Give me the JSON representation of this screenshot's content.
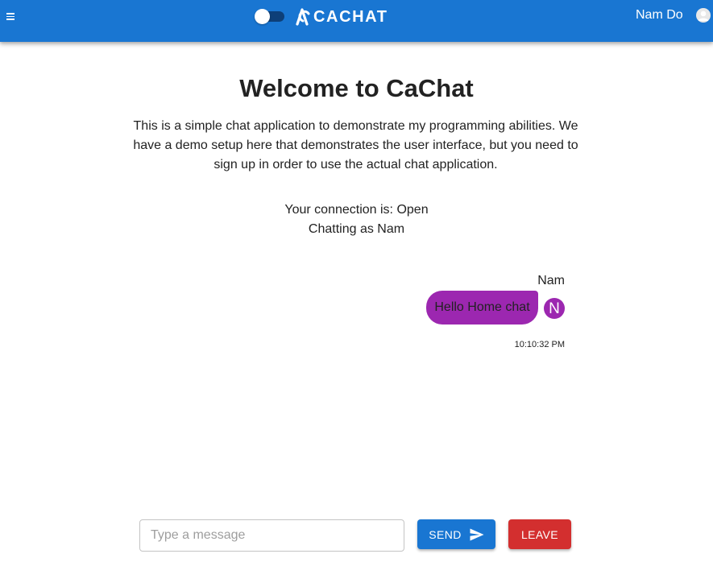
{
  "header": {
    "app_name": "CACHAT",
    "user_name": "Nam Do",
    "brand_color": "#1976d2",
    "icons": {
      "menu": "hamburger-menu-icon",
      "theme_toggle": "toggle-switch",
      "logo": "cachat-logo-icon",
      "user": "account-circle-icon"
    }
  },
  "main": {
    "title": "Welcome to CaChat",
    "intro": "This is a simple chat application to demonstrate my programming abilities. We have a demo setup here that demonstrates the user interface, but you need to sign up in order to use the actual chat application.",
    "connection_status": "Your connection is: Open",
    "chatting_as": "Chatting as Nam"
  },
  "messages": [
    {
      "sender": "Nam",
      "text": "Hello Home chat",
      "avatar_letter": "N",
      "time": "10:10:32 PM",
      "bubble_color": "#9c27b0"
    }
  ],
  "composer": {
    "placeholder": "Type a message",
    "value": "",
    "send_label": "SEND",
    "leave_label": "LEAVE",
    "send_color": "#1976d2",
    "leave_color": "#d32f2f",
    "send_icon": "send-icon"
  }
}
